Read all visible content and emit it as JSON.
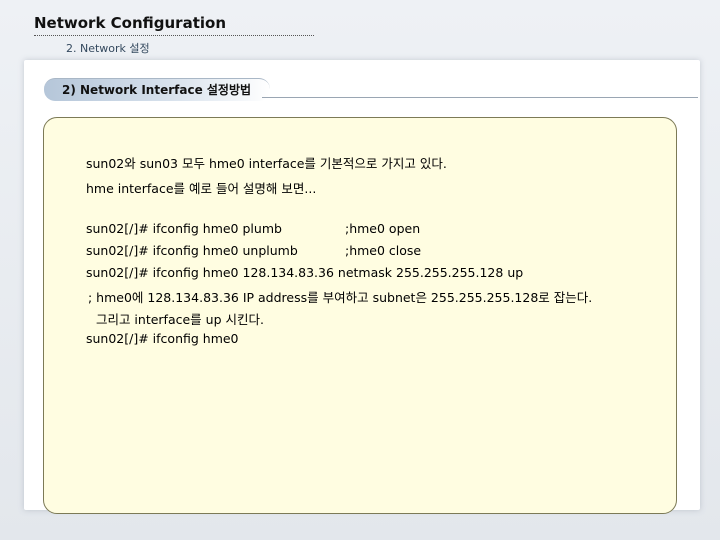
{
  "header": {
    "title": "Network Configuration",
    "subtitle": "2. Network 설정"
  },
  "section": {
    "label": "2) Network Interface 설정방법"
  },
  "body": {
    "intro": [
      "sun02와 sun03 모두 hme0 interface를 기본적으로 가지고 있다.",
      "hme interface를 예로 들어 설명해 보면..."
    ],
    "commands": [
      {
        "command": "sun02[/]# ifconfig hme0 plumb",
        "comment": ";hme0 open"
      },
      {
        "command": "sun02[/]# ifconfig hme0 unplumb",
        "comment": ";hme0 close"
      },
      {
        "command": "sun02[/]# ifconfig hme0 128.134.83.36 netmask 255.255.255.128 up",
        "comment": ""
      }
    ],
    "explanation": [
      "; hme0에 128.134.83.36 IP address를 부여하고 subnet은 255.255.255.128로 잡는다.",
      "  그리고 interface를 up 시킨다."
    ],
    "last_command": "sun02[/]# ifconfig hme0"
  }
}
